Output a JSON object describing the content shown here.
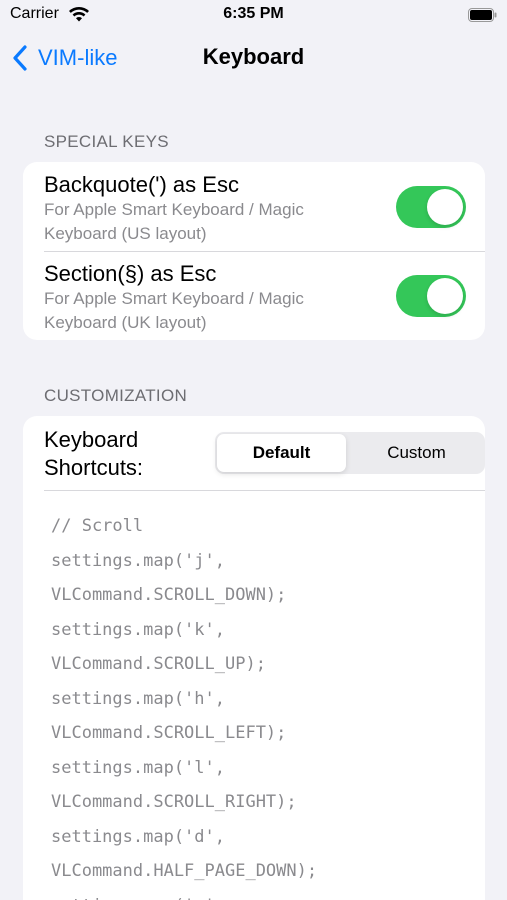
{
  "status_bar": {
    "carrier": "Carrier",
    "time": "6:35 PM",
    "wifi_icon": "wifi-icon",
    "battery_icon": "battery-icon"
  },
  "nav": {
    "back_label": "VIM-like",
    "back_icon": "chevron-left-icon",
    "title": "Keyboard"
  },
  "special_keys": {
    "header": "SPECIAL KEYS",
    "rows": [
      {
        "title": "Backquote(') as Esc",
        "subtitle": "For Apple Smart Keyboard / Magic Keyboard (US layout)",
        "enabled": true
      },
      {
        "title": "Section(§) as Esc",
        "subtitle": "For Apple Smart Keyboard / Magic Keyboard (UK layout)",
        "enabled": true
      }
    ]
  },
  "customization": {
    "header": "CUSTOMIZATION",
    "shortcut_label": "Keyboard Shortcuts:",
    "segments": [
      "Default",
      "Custom"
    ],
    "selected_segment": "Default",
    "code_lines": [
      "// Scroll",
      "settings.map('j',",
      "VLCommand.SCROLL_DOWN);",
      "settings.map('k',",
      "VLCommand.SCROLL_UP);",
      "settings.map('h',",
      "VLCommand.SCROLL_LEFT);",
      "settings.map('l',",
      "VLCommand.SCROLL_RIGHT);",
      "settings.map('d',",
      "VLCommand.HALF_PAGE_DOWN);",
      "settings.map('u',"
    ]
  },
  "colors": {
    "accent": "#0a7aff",
    "toggle_on": "#34c759",
    "background": "#f2f2f7",
    "secondary_text": "#8a8a8e"
  }
}
